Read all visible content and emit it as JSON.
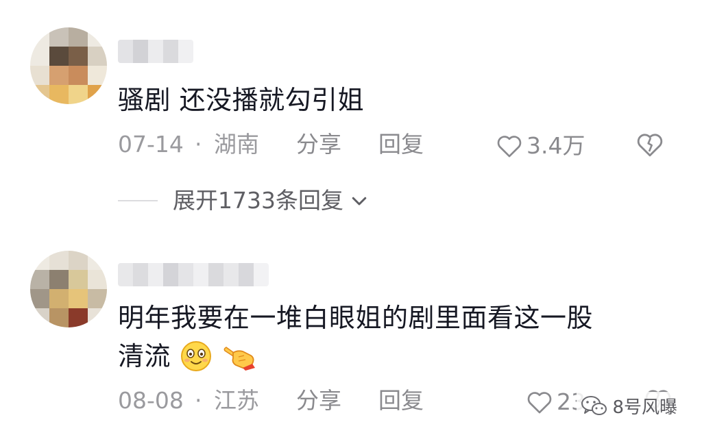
{
  "comments": [
    {
      "text": "骚剧 还没播就勾引姐",
      "date": "07-14",
      "separator": "·",
      "location": "湖南",
      "share_label": "分享",
      "reply_label": "回复",
      "like_count": "3.4万"
    },
    {
      "text_line1": "明年我要在一堆白眼姐的剧里面看这一股",
      "text_line2": "清流",
      "date": "08-08",
      "separator": "·",
      "location": "江苏",
      "share_label": "分享",
      "reply_label": "回复",
      "like_count": "23"
    }
  ],
  "expand_replies": {
    "label": "展开1733条回复"
  },
  "watermark": {
    "text": "8号风曝"
  },
  "icons": {
    "like": "heart-outline-icon",
    "dislike": "broken-heart-icon",
    "expand": "chevron-down-icon",
    "emoji_smile": "smiling-face-emoji",
    "emoji_point": "pointing-hand-emoji",
    "watermark_logo": "wechat-icon"
  },
  "colors": {
    "text": "#161823",
    "meta": "#9a9a9e",
    "divider": "#dcdcdf"
  }
}
